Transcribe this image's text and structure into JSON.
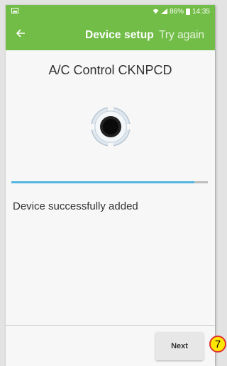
{
  "status_bar": {
    "battery": "86%",
    "time": "14:35",
    "left_icon": "image-notification-icon",
    "right_icons": [
      "wifi-icon",
      "signal-icon",
      "battery-icon"
    ]
  },
  "toolbar": {
    "back_icon": "arrow-left-icon",
    "title": "Device setup",
    "action_label": "Try again"
  },
  "content": {
    "device_name": "A/C Control CKNPCD",
    "device_icon": "ac-controller-icon",
    "progress_fraction": 0.93,
    "status_message": "Device successfully added"
  },
  "footer": {
    "next_label": "Next"
  },
  "annotation": {
    "step_number": "7"
  },
  "colors": {
    "header_green": "#72bd47",
    "progress_blue": "#54b6e0",
    "marker_yellow": "#ffe600",
    "marker_red": "#e03030"
  }
}
